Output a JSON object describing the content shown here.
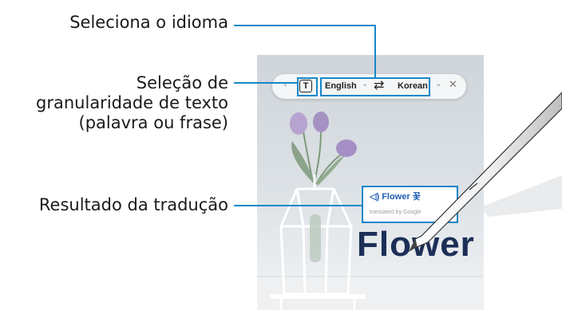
{
  "callouts": {
    "language": "Seleciona o idioma",
    "granularity_line1": "Seleção de",
    "granularity_line2": "granularidade de texto",
    "granularity_line3": "(palavra ou frase)",
    "result": "Resultado da tradução"
  },
  "toolbar": {
    "back_icon": "chevron-left-icon",
    "text_mode_icon": "text-box-icon",
    "text_mode_label": "T",
    "source_language": "English",
    "target_language": "Korean",
    "swap_icon": "swap-arrows-icon",
    "close_icon": "close-icon"
  },
  "translation_popup": {
    "speaker_icon": "speaker-icon",
    "word": "Flower",
    "translation": "꽃",
    "credit": "translated by Google"
  },
  "screen_text": "Flower",
  "colors": {
    "highlight": "#1687c9",
    "leader_line": "#1687c9",
    "popup_word": "#1f5fb5",
    "screen_text": "#1b2f57"
  }
}
